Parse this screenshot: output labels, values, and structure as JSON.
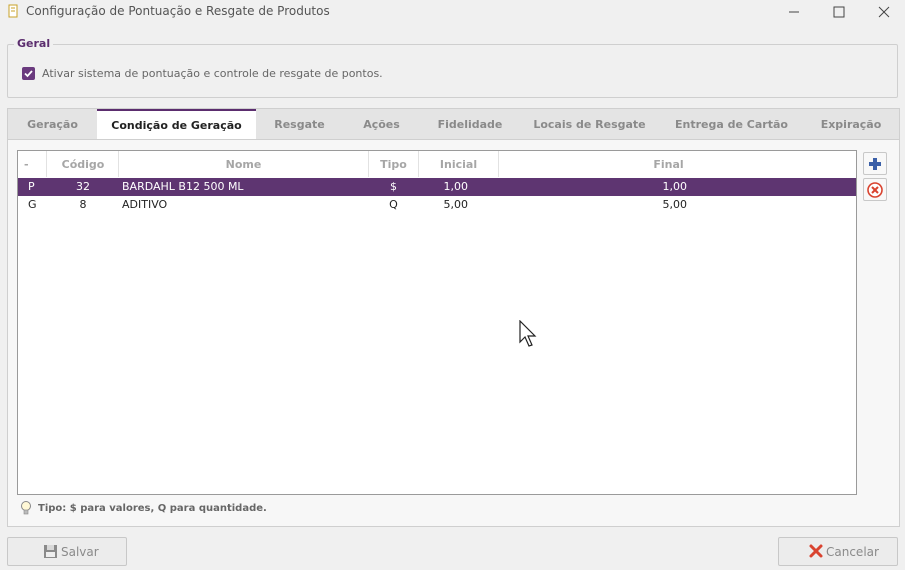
{
  "window": {
    "title": "Configuração de Pontuação e Resgate de Produtos"
  },
  "geral": {
    "legend": "Geral",
    "checkbox_label": "Ativar sistema de pontuação e controle de resgate de pontos.",
    "checked": true
  },
  "tabs": [
    {
      "label": "Geração"
    },
    {
      "label": "Condição de Geração",
      "active": true
    },
    {
      "label": "Resgate"
    },
    {
      "label": "Ações"
    },
    {
      "label": "Fidelidade"
    },
    {
      "label": "Locais de Resgate"
    },
    {
      "label": "Entrega de Cartão"
    },
    {
      "label": "Expiração"
    }
  ],
  "grid": {
    "columns": [
      "-",
      "Código",
      "Nome",
      "Tipo",
      "Inicial",
      "Final"
    ],
    "rows": [
      [
        "P",
        "32",
        "BARDAHL B12 500 ML",
        "$",
        "1,00",
        "1,00"
      ],
      [
        "G",
        "8",
        "ADITIVO",
        "Q",
        "5,00",
        "5,00"
      ]
    ],
    "selected_row": 0
  },
  "hint": "Tipo: $ para valores, Q para quantidade.",
  "buttons": {
    "save": "Salvar",
    "cancel": "Cancelar"
  },
  "colors": {
    "accent": "#5e3571",
    "remove": "#d9432f",
    "add": "#3a5fa8"
  },
  "icons": [
    "app-icon",
    "minimize-icon",
    "maximize-icon",
    "close-icon",
    "checkbox-checked-icon",
    "add-icon",
    "remove-icon",
    "lightbulb-icon",
    "save-icon",
    "cancel-icon"
  ]
}
